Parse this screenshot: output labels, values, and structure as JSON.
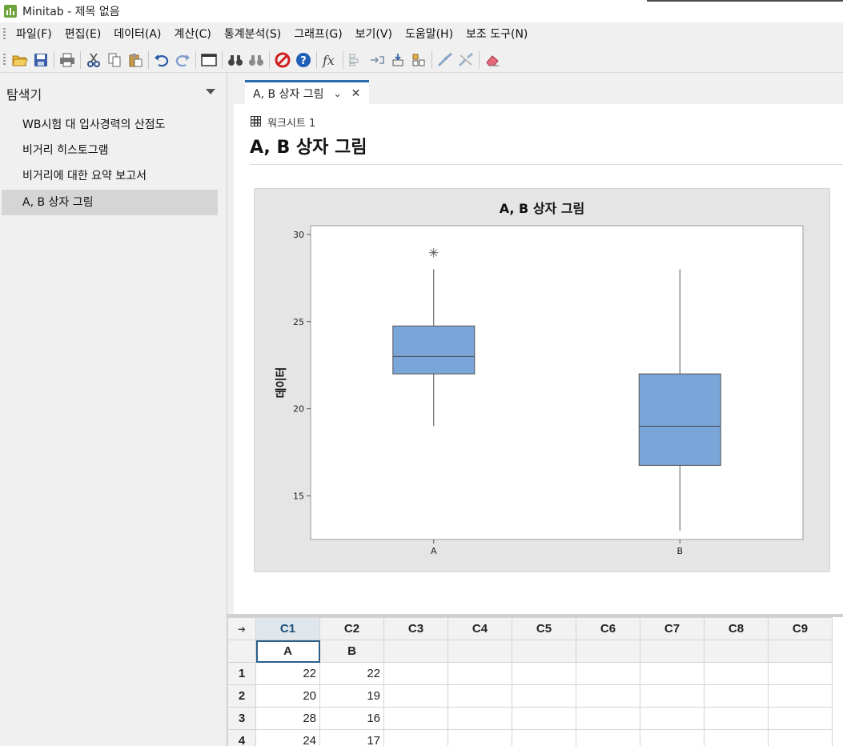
{
  "window": {
    "title": "Minitab - 제목 없음"
  },
  "menu": [
    "파일(F)",
    "편집(E)",
    "데이터(A)",
    "계산(C)",
    "통계분석(S)",
    "그래프(G)",
    "보기(V)",
    "도움말(H)",
    "보조 도구(N)"
  ],
  "toolbar": {
    "icons": [
      "open-icon",
      "save-icon",
      "print-icon",
      "cut-icon",
      "copy-icon",
      "paste-icon",
      "undo-icon",
      "redo-icon",
      "window-icon",
      "find-icon",
      "find-replace-icon",
      "cancel-icon",
      "help-icon",
      "function-icon",
      "insert-cells-icon",
      "insert-rows-icon",
      "insert-columns-icon",
      "move-columns-icon",
      "brush-icon",
      "brush-off-icon",
      "eraser-icon"
    ]
  },
  "explorer": {
    "title": "탐색기",
    "items": [
      "WB시험 대 입사경력의 산점도",
      "비거리 히스토그램",
      "비거리에 대한 요약 보고서",
      "A, B 상자 그림"
    ],
    "selected_index": 3
  },
  "tab": {
    "label": "A, B 상자 그림"
  },
  "output": {
    "worksheet_label": "워크시트 1",
    "title": "A, B 상자 그림"
  },
  "chart_data": {
    "type": "boxplot",
    "title": "A, B 상자 그림",
    "xlabel": "",
    "ylabel": "데이터",
    "ylim": [
      12.5,
      30.5
    ],
    "yticks": [
      15,
      20,
      25,
      30
    ],
    "categories": [
      "A",
      "B"
    ],
    "boxes": [
      {
        "category": "A",
        "whisker_low": 19,
        "q1": 22,
        "median": 23,
        "q3": 24.75,
        "whisker_high": 28,
        "outliers": [
          29
        ]
      },
      {
        "category": "B",
        "whisker_low": 13,
        "q1": 16.75,
        "median": 19,
        "q3": 22,
        "whisker_high": 28,
        "outliers": []
      }
    ],
    "box_color": "#7aa5d8",
    "grid": false
  },
  "sheet": {
    "columns": [
      "C1",
      "C2",
      "C3",
      "C4",
      "C5",
      "C6",
      "C7",
      "C8",
      "C9"
    ],
    "names": [
      "A",
      "B",
      "",
      "",
      "",
      "",
      "",
      "",
      ""
    ],
    "rows": [
      {
        "n": "1",
        "A": "22",
        "B": "22"
      },
      {
        "n": "2",
        "A": "20",
        "B": "19"
      },
      {
        "n": "3",
        "A": "28",
        "B": "16"
      },
      {
        "n": "4",
        "A": "24",
        "B": "17"
      }
    ]
  }
}
